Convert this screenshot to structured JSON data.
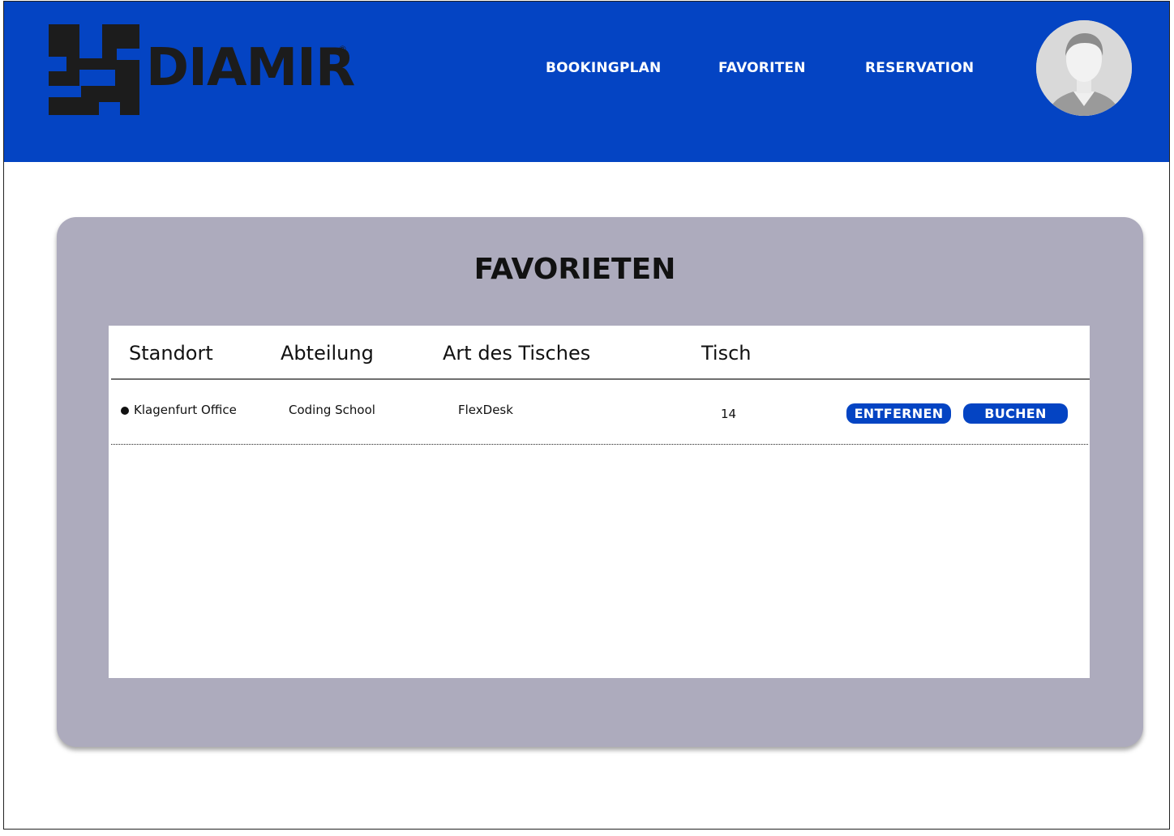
{
  "brand": {
    "name": "DIAMIR",
    "registered_mark": "®",
    "color": "#1c1c1c"
  },
  "nav": {
    "items": [
      {
        "label": "BOOKINGPLAN"
      },
      {
        "label": "FAVORITEN"
      },
      {
        "label": "RESERVATION"
      }
    ]
  },
  "profile": {
    "icon": "user-avatar"
  },
  "colors": {
    "header": "#0444c3",
    "panel": "#adabbd",
    "button": "#0444c3"
  },
  "page": {
    "title": "FAVORIETEN"
  },
  "table": {
    "columns": [
      "Standort",
      "Abteilung",
      "Art des Tisches",
      "Tisch"
    ],
    "rows": [
      {
        "standort": "Klagenfurt Office",
        "abteilung": "Coding School",
        "art": "FlexDesk",
        "tisch": "14",
        "remove_label": "ENTFERNEN",
        "book_label": "BUCHEN"
      }
    ]
  }
}
